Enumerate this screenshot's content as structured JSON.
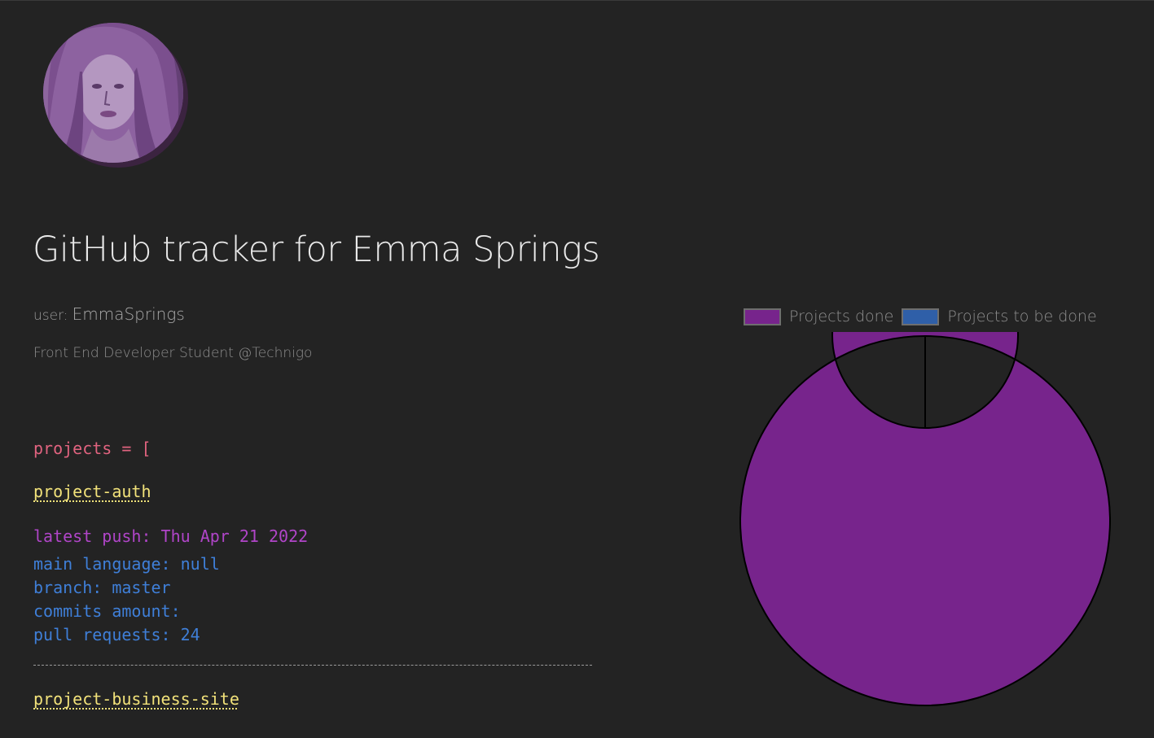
{
  "profile": {
    "title": "GitHub tracker for Emma Springs",
    "user_label": "user:",
    "username": "EmmaSprings",
    "bio": "Front End Developer Student @Technigo"
  },
  "projects_header": "projects = [",
  "projects": [
    {
      "name": "project-auth",
      "latest_push": "latest push: Thu Apr 21 2022",
      "main_language": "main language: null",
      "branch": "branch: master",
      "commits": "commits amount:",
      "pull_requests": "pull requests: 24"
    },
    {
      "name": "project-business-site"
    }
  ],
  "colors": {
    "background": "#232323",
    "done": "#77248c",
    "todo": "#2f5fa8",
    "repo_link": "#f2e27a",
    "push": "#b045c8",
    "info": "#3f7fd8",
    "bracket": "#e0637f"
  },
  "chart_data": {
    "type": "pie",
    "variant": "doughnut",
    "labels": [
      "Projects done",
      "Projects to be done"
    ],
    "values": [
      1,
      0
    ],
    "colors": [
      "#77248c",
      "#2f5fa8"
    ],
    "legend": "top"
  }
}
